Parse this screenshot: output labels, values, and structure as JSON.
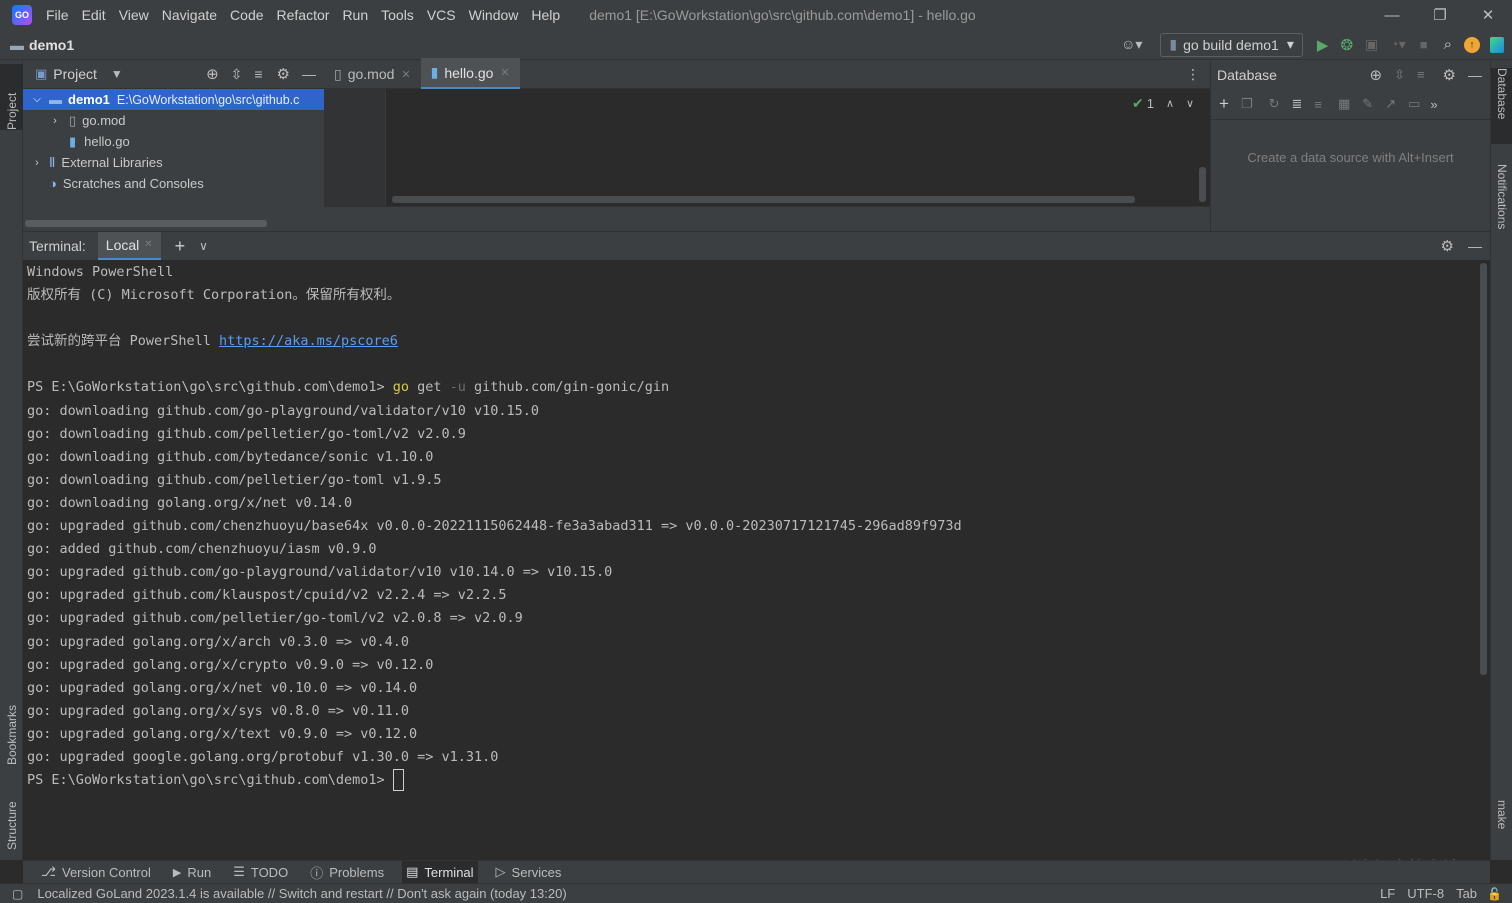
{
  "title_bar": {
    "menu": [
      "File",
      "Edit",
      "View",
      "Navigate",
      "Code",
      "Refactor",
      "Run",
      "Tools",
      "VCS",
      "Window",
      "Help"
    ],
    "window_title": "demo1 [E:\\GoWorkstation\\go\\src\\github.com\\demo1] - hello.go"
  },
  "nav_bar": {
    "project_name": "demo1",
    "run_config": "go build demo1"
  },
  "left_stripe": {
    "project": "Project",
    "bookmarks": "Bookmarks",
    "structure": "Structure"
  },
  "right_stripe": {
    "database": "Database",
    "notifications": "Notifications",
    "make": "make"
  },
  "project_panel": {
    "title": "Project",
    "tree": [
      {
        "label": "demo1",
        "path": "E:\\GoWorkstation\\go\\src\\github.c"
      },
      {
        "label": "go.mod"
      },
      {
        "label": "hello.go"
      },
      {
        "label": "External Libraries"
      },
      {
        "label": "Scratches and Consoles"
      }
    ]
  },
  "editor": {
    "tabs": [
      {
        "label": "go.mod"
      },
      {
        "label": "hello.go"
      }
    ],
    "inspection_count": "1"
  },
  "database_panel": {
    "title": "Database",
    "empty_text": "Create a data source with Alt+Insert"
  },
  "terminal": {
    "label": "Terminal:",
    "tab": "Local",
    "lines": {
      "l1": "Windows PowerShell",
      "l2": "版权所有 (C) Microsoft Corporation。保留所有权利。",
      "l3_prefix": "尝试新的跨平台 PowerShell ",
      "l3_link": "https://aka.ms/pscore6",
      "prompt": "PS E:\\GoWorkstation\\go\\src\\github.com\\demo1> ",
      "cmd_go": "go",
      "cmd_get": " get ",
      "cmd_flag": "-u",
      "cmd_arg": " github.com/gin-gonic/gin",
      "output": [
        "go: downloading github.com/go-playground/validator/v10 v10.15.0",
        "go: downloading github.com/pelletier/go-toml/v2 v2.0.9",
        "go: downloading github.com/bytedance/sonic v1.10.0",
        "go: downloading github.com/pelletier/go-toml v1.9.5",
        "go: downloading golang.org/x/net v0.14.0",
        "go: upgraded github.com/chenzhuoyu/base64x v0.0.0-20221115062448-fe3a3abad311 => v0.0.0-20230717121745-296ad89f973d",
        "go: added github.com/chenzhuoyu/iasm v0.9.0",
        "go: upgraded github.com/go-playground/validator/v10 v10.14.0 => v10.15.0",
        "go: upgraded github.com/klauspost/cpuid/v2 v2.2.4 => v2.2.5",
        "go: upgraded github.com/pelletier/go-toml/v2 v2.0.8 => v2.0.9",
        "go: upgraded golang.org/x/arch v0.3.0 => v0.4.0",
        "go: upgraded golang.org/x/crypto v0.9.0 => v0.12.0",
        "go: upgraded golang.org/x/net v0.10.0 => v0.14.0",
        "go: upgraded golang.org/x/sys v0.8.0 => v0.11.0",
        "go: upgraded golang.org/x/text v0.9.0 => v0.12.0",
        "go: upgraded google.golang.org/protobuf v1.30.0 => v1.31.0"
      ]
    }
  },
  "tool_windows": [
    "Version Control",
    "Run",
    "TODO",
    "Problems",
    "Terminal",
    "Services"
  ],
  "status_bar": {
    "message": "Localized GoLand 2023.1.4 is available // Switch and restart // Don't ask again (today 13:20)",
    "line_sep": "LF",
    "encoding": "UTF-8",
    "indent": "Tab"
  },
  "watermark": "@稀土掘金技术社区",
  "colors": {
    "accent": "#2f65ca",
    "link": "#589df6",
    "cmd": "#d7c84f",
    "run_green": "#59a869"
  }
}
